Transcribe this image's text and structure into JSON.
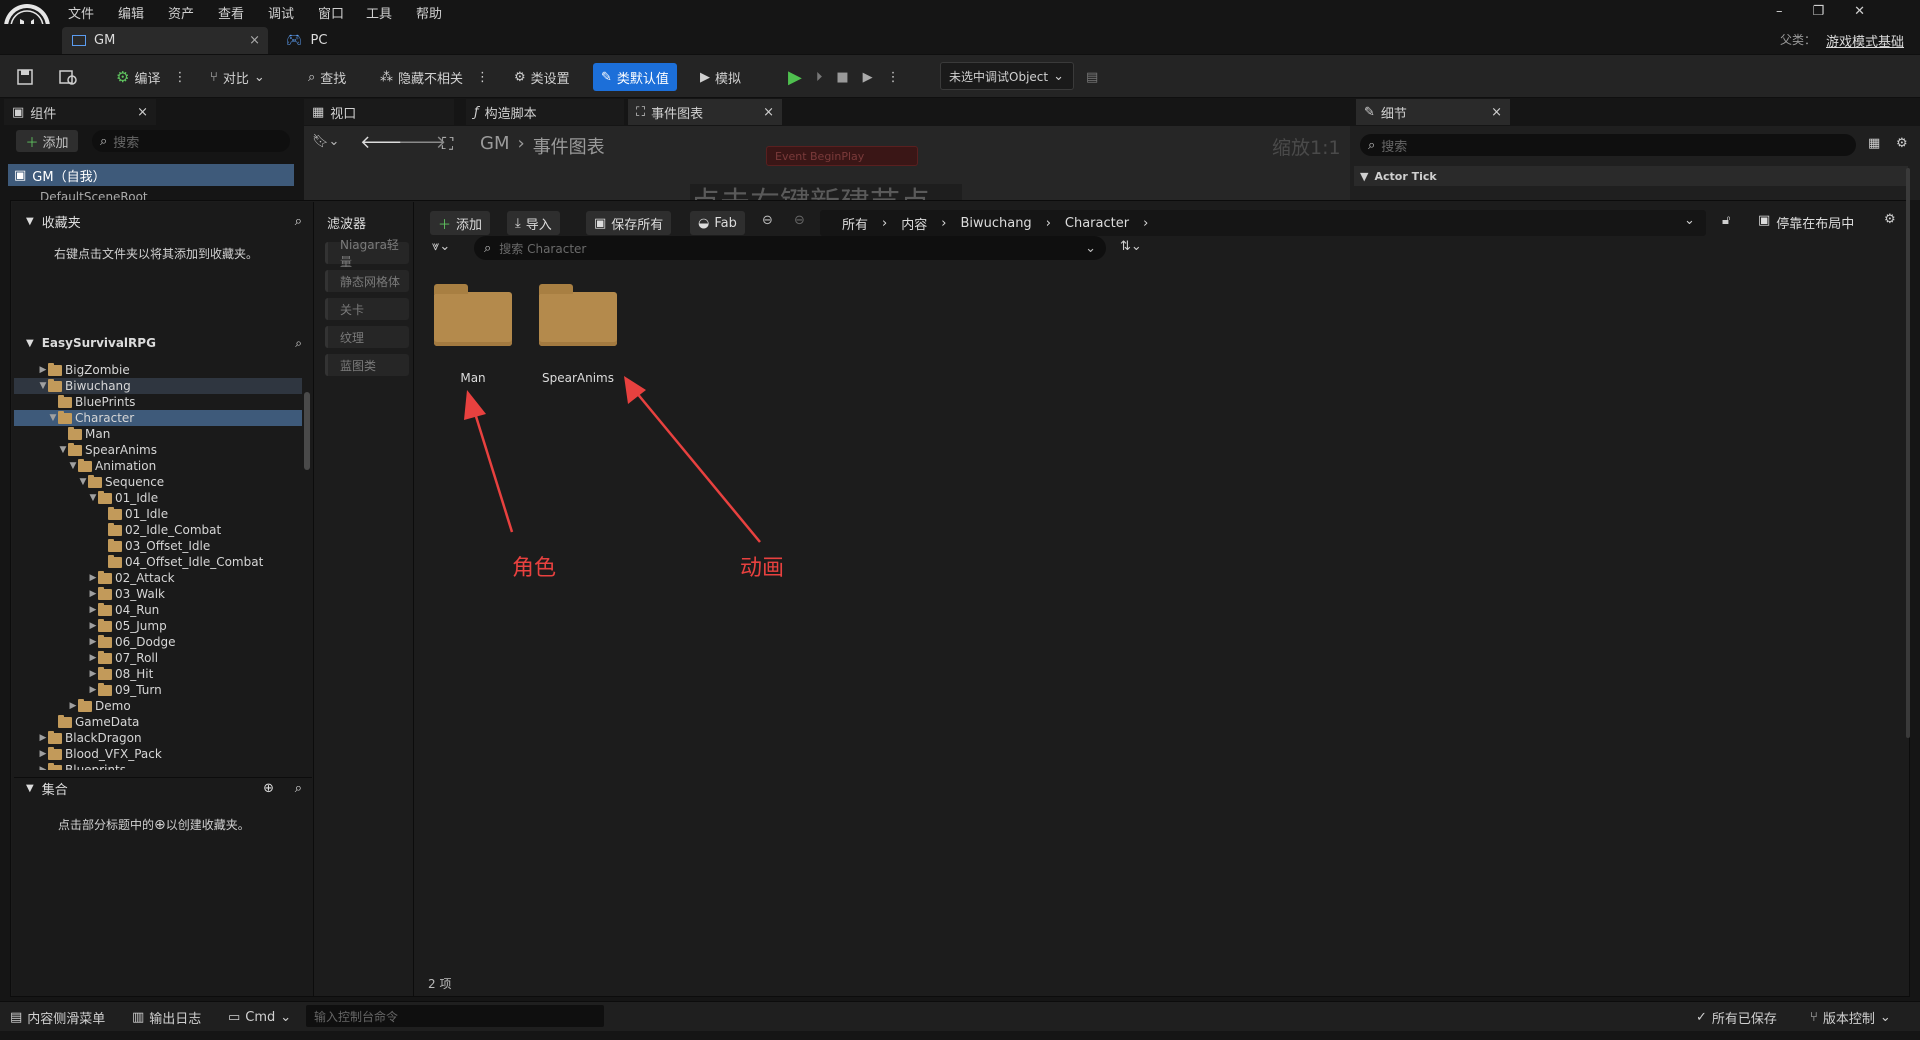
{
  "app": {
    "menu": [
      "文件",
      "编辑",
      "资产",
      "查看",
      "调试",
      "窗口",
      "工具",
      "帮助"
    ],
    "doc_tabs": [
      {
        "label": "GM",
        "close": "×"
      },
      {
        "label": "PC"
      }
    ],
    "parent_class_label": "父类：",
    "parent_class_value": "游戏模式基础"
  },
  "toolbar": {
    "compile": "编译",
    "diff": "对比",
    "find": "查找",
    "hide_unrelated": "隐藏不相关",
    "class_settings": "类设置",
    "class_defaults": "类默认值",
    "simulate": "模拟",
    "debug_object": "未选中调试Object"
  },
  "components_panel": {
    "title": "组件",
    "add": "添加",
    "search_placeholder": "搜索",
    "root_item": "GM（自我）",
    "child_item": "DefaultSceneRoot"
  },
  "graph_tabs": {
    "viewport": "视口",
    "construction": "构造脚本",
    "event_graph": "事件图表"
  },
  "graph": {
    "breadcrumb_root": "GM",
    "breadcrumb_current": "事件图表",
    "zoom": "缩放1:1",
    "node": "Event BeginPlay",
    "overlay_text": "点击右键新建节点"
  },
  "details_panel": {
    "title": "细节",
    "search_placeholder": "搜索",
    "section": "Actor Tick"
  },
  "content_browser": {
    "favorites_title": "收藏夹",
    "favorites_hint": "右键点击文件夹以将其添加到收藏夹。",
    "project_title": "EasySurvivalRPG",
    "tree": [
      {
        "label": "BigZombie",
        "depth": 1,
        "arrow": "▶"
      },
      {
        "label": "Biwuchang",
        "depth": 1,
        "arrow": "▼",
        "hl": true
      },
      {
        "label": "BluePrints",
        "depth": 2,
        "arrow": ""
      },
      {
        "label": "Character",
        "depth": 2,
        "arrow": "▼",
        "sel": true
      },
      {
        "label": "Man",
        "depth": 3,
        "arrow": ""
      },
      {
        "label": "SpearAnims",
        "depth": 3,
        "arrow": "▼"
      },
      {
        "label": "Animation",
        "depth": 4,
        "arrow": "▼"
      },
      {
        "label": "Sequence",
        "depth": 5,
        "arrow": "▼"
      },
      {
        "label": "01_Idle",
        "depth": 6,
        "arrow": "▼"
      },
      {
        "label": "01_Idle",
        "depth": 7,
        "arrow": ""
      },
      {
        "label": "02_Idle_Combat",
        "depth": 7,
        "arrow": ""
      },
      {
        "label": "03_Offset_Idle",
        "depth": 7,
        "arrow": ""
      },
      {
        "label": "04_Offset_Idle_Combat",
        "depth": 7,
        "arrow": ""
      },
      {
        "label": "02_Attack",
        "depth": 6,
        "arrow": "▶"
      },
      {
        "label": "03_Walk",
        "depth": 6,
        "arrow": "▶"
      },
      {
        "label": "04_Run",
        "depth": 6,
        "arrow": "▶"
      },
      {
        "label": "05_Jump",
        "depth": 6,
        "arrow": "▶"
      },
      {
        "label": "06_Dodge",
        "depth": 6,
        "arrow": "▶"
      },
      {
        "label": "07_Roll",
        "depth": 6,
        "arrow": "▶"
      },
      {
        "label": "08_Hit",
        "depth": 6,
        "arrow": "▶"
      },
      {
        "label": "09_Turn",
        "depth": 6,
        "arrow": "▶"
      },
      {
        "label": "Demo",
        "depth": 4,
        "arrow": "▶"
      },
      {
        "label": "GameData",
        "depth": 2,
        "arrow": ""
      },
      {
        "label": "BlackDragon",
        "depth": 1,
        "arrow": "▶"
      },
      {
        "label": "Blood_VFX_Pack",
        "depth": 1,
        "arrow": "▶"
      },
      {
        "label": "Blueprints",
        "depth": 1,
        "arrow": "▶"
      }
    ],
    "collections_title": "集合",
    "collections_hint_pre": "点击部分标题中的",
    "collections_hint_post": "以创建收藏夹。",
    "filters_title": "滤波器",
    "filters": [
      "Niagara轻量",
      "静态网格体",
      "关卡",
      "纹理",
      "蓝图类"
    ],
    "add": "添加",
    "import": "导入",
    "save_all": "保存所有",
    "fab": "Fab",
    "path": [
      "所有",
      "内容",
      "Biwuchang",
      "Character"
    ],
    "dock_in_layout": "停靠在布局中",
    "search_placeholder": "搜索 Character",
    "assets": [
      "Man",
      "SpearAnims"
    ],
    "item_count": "2 项"
  },
  "annotations": {
    "left": "角色",
    "right": "动画"
  },
  "statusbar": {
    "drawer": "内容侧滑菜单",
    "output_log": "输出日志",
    "cmd": "Cmd",
    "console_placeholder": "输入控制台命令",
    "all_saved": "所有已保存",
    "source_control": "版本控制"
  }
}
